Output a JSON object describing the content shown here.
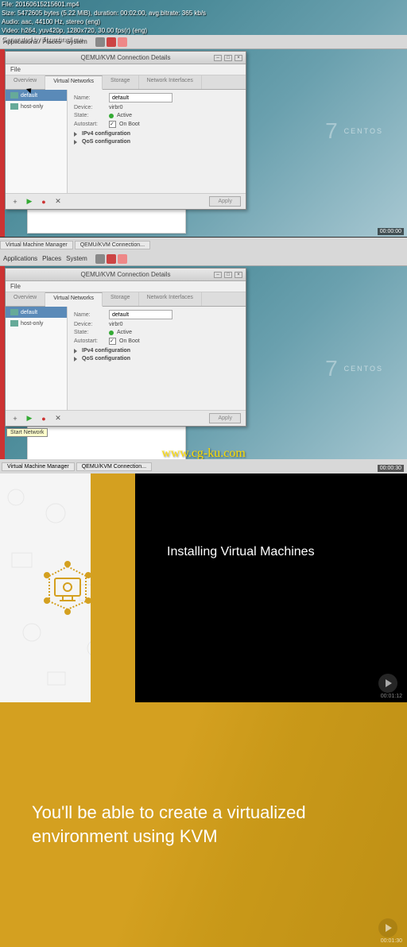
{
  "meta": {
    "l1": "File: 20160615215601.mp4",
    "l2": "Size: 5472605 bytes (5.22 MiB), duration: 00:02:00, avg.bitrate: 365 kb/s",
    "l3": "Audio: aac, 44100 Hz, stereo (eng)",
    "l4": "Video: h264, yuv420p, 1280x720, 30.00 fps(r) (eng)",
    "l5": "Generated by Thumbnail me"
  },
  "topmenu": {
    "apps": "Applications",
    "places": "Places",
    "system": "System"
  },
  "window": {
    "title": "QEMU/KVM Connection Details",
    "file": "File",
    "tabs": {
      "overview": "Overview",
      "vnet": "Virtual Networks",
      "storage": "Storage",
      "nif": "Network Interfaces"
    },
    "sidebar": {
      "default": "default",
      "hostonly": "host-only"
    },
    "fields": {
      "name_lbl": "Name:",
      "name_val": "default",
      "device_lbl": "Device:",
      "device_val": "virbr0",
      "state_lbl": "State:",
      "state_val": "Active",
      "auto_lbl": "Autostart:",
      "auto_val": "On Boot",
      "ipv4": "IPv4 configuration",
      "qos": "QoS configuration"
    },
    "apply": "Apply",
    "tooltip": "Start Network"
  },
  "taskbar": {
    "vmm": "Virtual Machine Manager",
    "conn": "QEMU/KVM Connection..."
  },
  "centos": {
    "seven": "7",
    "label": "CENTOS"
  },
  "watermark": "www.cg-ku.com",
  "time1": "00:00:00",
  "time2": "00:00:30",
  "slide3": {
    "title": "Installing Virtual Machines",
    "time": "00:01:12"
  },
  "slide4": {
    "text": "You'll be able to create a virtualized environment using KVM",
    "time": "00:01:30"
  }
}
